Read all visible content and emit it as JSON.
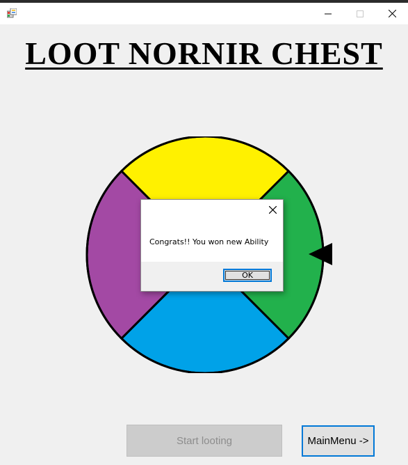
{
  "window": {
    "title": "",
    "icon": "winforms-app-icon",
    "controls": [
      "minimize-icon",
      "maximize-icon",
      "close-icon"
    ]
  },
  "page": {
    "title": "LOOT NORNIR CHEST"
  },
  "wheel": {
    "segments": [
      {
        "name": "top",
        "color": "#fff100"
      },
      {
        "name": "right",
        "color": "#22b14c"
      },
      {
        "name": "bottom",
        "color": "#00a2e8"
      },
      {
        "name": "left",
        "color": "#a349a4"
      }
    ],
    "pointer_icon": "pointer-triangle-icon"
  },
  "dialog": {
    "message": "Congrats!! You won new Ability",
    "ok_label": "OK",
    "close_icon": "close-icon"
  },
  "buttons": {
    "start_label": "Start looting",
    "start_enabled": false,
    "menu_label": "MainMenu ->"
  },
  "colors": {
    "accent": "#0078d7",
    "background": "#f0f0f0"
  }
}
